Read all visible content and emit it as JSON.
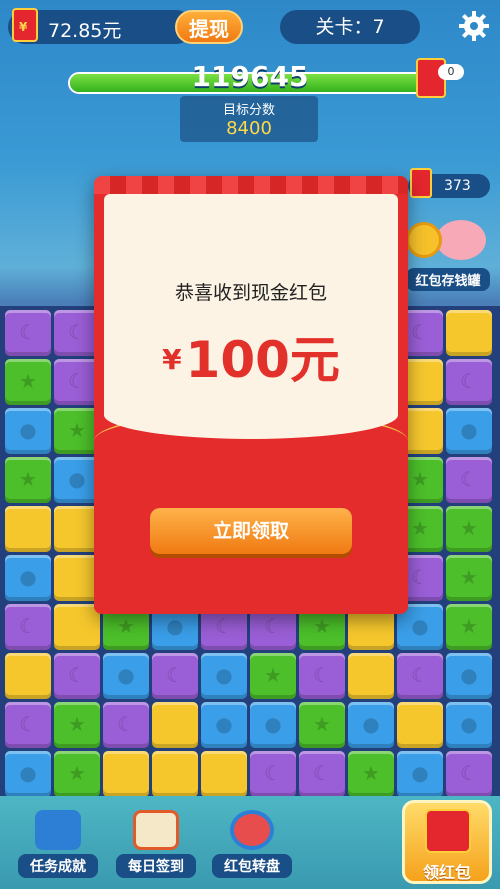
{
  "header": {
    "balance": "72.85元",
    "withdraw_label": "提现",
    "level_label": "关卡：7"
  },
  "score": {
    "current": "119645",
    "target_label": "目标分数",
    "target_value": "8400",
    "redpack_count": "0",
    "progress": 1.0
  },
  "side": {
    "redpack_count": "373",
    "piggy_label": "红包存钱罐"
  },
  "modal": {
    "headline": "恭喜收到现金红包",
    "currency": "¥",
    "amount": "100元",
    "claim_label": "立即领取"
  },
  "bottom_nav": {
    "items": [
      {
        "label": "任务成就",
        "icon": "book-icon"
      },
      {
        "label": "每日签到",
        "icon": "calendar-icon"
      },
      {
        "label": "红包转盘",
        "icon": "wheel-icon"
      }
    ],
    "claim_label": "领红包"
  },
  "board": {
    "rows": [
      [
        "purple",
        "purple",
        "green",
        "blue",
        "yellow",
        "purple",
        "green",
        "purple",
        "purple",
        "yellow"
      ],
      [
        "green",
        "purple",
        "yellow",
        "green",
        "blue",
        "yellow",
        "purple",
        "green",
        "yellow",
        "purple"
      ],
      [
        "blue",
        "green",
        "purple",
        "yellow",
        "green",
        "blue",
        "yellow",
        "purple",
        "yellow",
        "blue"
      ],
      [
        "green",
        "blue",
        "yellow",
        "purple",
        "blue",
        "green",
        "purple",
        "yellow",
        "green",
        "purple"
      ],
      [
        "yellow",
        "yellow",
        "green",
        "blue",
        "purple",
        "yellow",
        "blue",
        "green",
        "green",
        "green"
      ],
      [
        "blue",
        "yellow",
        "purple",
        "green",
        "yellow",
        "purple",
        "green",
        "blue",
        "purple",
        "green"
      ],
      [
        "purple",
        "yellow",
        "green",
        "blue",
        "purple",
        "purple",
        "green",
        "yellow",
        "blue",
        "green"
      ],
      [
        "yellow",
        "purple",
        "blue",
        "purple",
        "blue",
        "green",
        "purple",
        "yellow",
        "purple",
        "blue"
      ],
      [
        "purple",
        "green",
        "purple",
        "yellow",
        "blue",
        "blue",
        "green",
        "blue",
        "yellow",
        "blue"
      ],
      [
        "blue",
        "green",
        "yellow",
        "yellow",
        "yellow",
        "purple",
        "purple",
        "green",
        "blue",
        "purple"
      ]
    ]
  }
}
